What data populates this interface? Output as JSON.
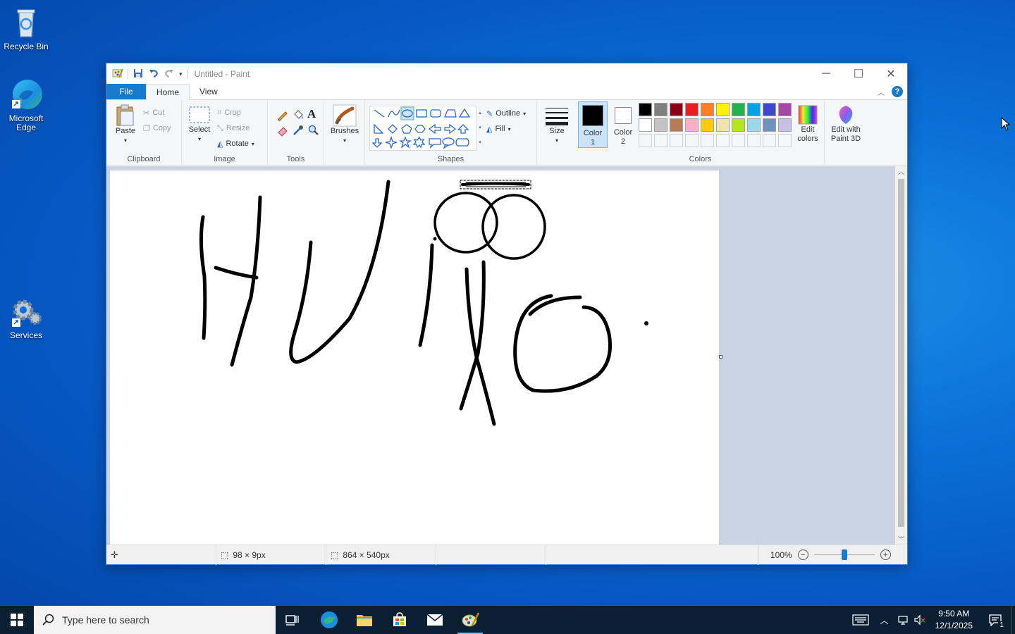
{
  "desktop": {
    "icons": [
      {
        "label": "Recycle Bin"
      },
      {
        "label": "Microsoft Edge"
      },
      {
        "label": "Services"
      }
    ]
  },
  "window": {
    "title": "Untitled - Paint",
    "tabs": {
      "file": "File",
      "home": "Home",
      "view": "View"
    },
    "clipboard": {
      "paste": "Paste",
      "cut": "Cut",
      "copy": "Copy",
      "label": "Clipboard"
    },
    "image": {
      "select": "Select",
      "crop": "Crop",
      "resize": "Resize",
      "rotate": "Rotate",
      "label": "Image"
    },
    "tools": {
      "label": "Tools"
    },
    "brushes": {
      "label": "Brushes"
    },
    "shapes": {
      "outline": "Outline",
      "fill": "Fill",
      "label": "Shapes"
    },
    "size": {
      "label": "Size"
    },
    "colors": {
      "color1": "Color 1",
      "color2": "Color 2",
      "edit": "Edit colors",
      "label": "Colors",
      "row1": [
        "#000000",
        "#7f7f7f",
        "#880015",
        "#ed1c24",
        "#ff7f27",
        "#fff200",
        "#22b14c",
        "#00a2e8",
        "#3f48cc",
        "#a349a4"
      ],
      "row2": [
        "#ffffff",
        "#c3c3c3",
        "#b97a57",
        "#ffaec9",
        "#ffc90e",
        "#efe4b0",
        "#b5e61d",
        "#99d9ea",
        "#7092be",
        "#c8bfe7"
      ]
    },
    "paint3d": "Edit with Paint 3D",
    "status": {
      "selection": "98 × 9px",
      "canvas_size": "864 × 540px",
      "zoom": "100%",
      "zoom_fraction": 0.5
    }
  },
  "taskbar": {
    "search_placeholder": "Type here to search",
    "time": "9:50 AM",
    "date": "12/1/2025",
    "notifications": "1"
  }
}
